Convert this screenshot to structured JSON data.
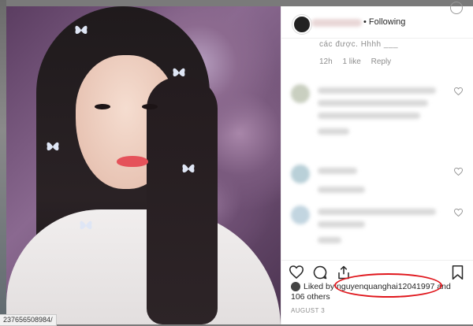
{
  "post": {
    "header": {
      "follow_status": "Following",
      "separator": "•"
    },
    "comments": {
      "partial_text": "các được. Hhhh  ___",
      "time_ago": "12h",
      "likes": "1 like",
      "reply_label": "Reply"
    },
    "likes_line": {
      "prefix": "Liked by ",
      "username": "nguyenquanghai12041997",
      "middle": " and",
      "others": "106 others"
    },
    "date": "AUGUST 3"
  },
  "status_url": "237656508984/",
  "icons": {
    "heart": "heart-icon",
    "comment": "comment-icon",
    "share": "share-icon",
    "bookmark": "bookmark-icon"
  },
  "colors": {
    "annotation": "#e0161c",
    "text_primary": "#262626",
    "text_secondary": "#8e8e8e"
  }
}
